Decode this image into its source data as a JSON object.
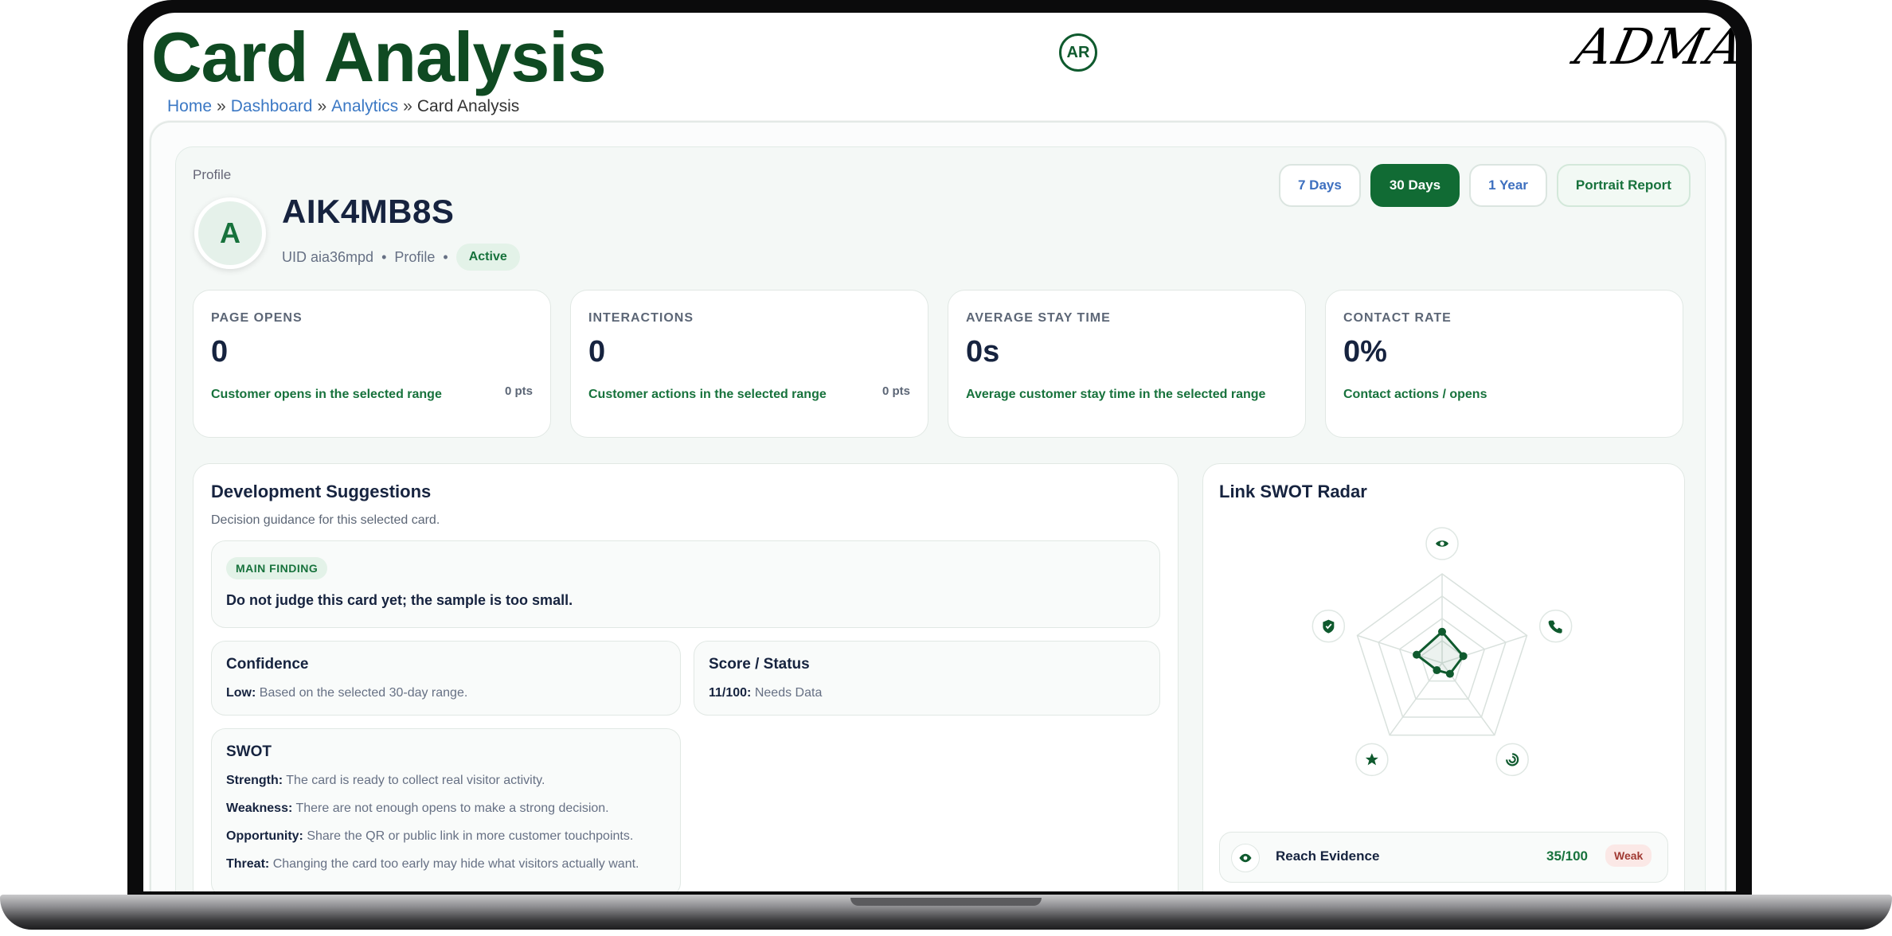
{
  "header": {
    "title": "Card Analysis",
    "user_initials": "AR",
    "brand": "ADMAL"
  },
  "breadcrumb": {
    "home": "Home",
    "dashboard": "Dashboard",
    "analytics": "Analytics",
    "current": "Card Analysis",
    "separator": "»"
  },
  "profile": {
    "section_label": "Profile",
    "avatar_letter": "A",
    "name": "AIK4MB8S",
    "uid": "UID aia36mpd",
    "type": "Profile",
    "bullet": "•",
    "status": "Active"
  },
  "range": {
    "options": [
      "7 Days",
      "30 Days",
      "1 Year"
    ],
    "selected": "30 Days",
    "report_label": "Portrait Report"
  },
  "kpis": [
    {
      "label": "PAGE OPENS",
      "value": "0",
      "desc": "Customer opens in the selected range",
      "pts": "0 pts"
    },
    {
      "label": "INTERACTIONS",
      "value": "0",
      "desc": "Customer actions in the selected range",
      "pts": "0 pts"
    },
    {
      "label": "AVERAGE STAY TIME",
      "value": "0s",
      "desc": "Average customer stay time in the selected range",
      "pts": ""
    },
    {
      "label": "CONTACT RATE",
      "value": "0%",
      "desc": "Contact actions / opens",
      "pts": ""
    }
  ],
  "development": {
    "title": "Development Suggestions",
    "subtitle": "Decision guidance for this selected card.",
    "finding_tag": "MAIN FINDING",
    "finding_text": "Do not judge this card yet; the sample is too small.",
    "confidence": {
      "title": "Confidence",
      "level": "Low:",
      "text": "Based on the selected 30-day range."
    },
    "score": {
      "title": "Score / Status",
      "value": "11/100:",
      "text": "Needs Data"
    },
    "swot": {
      "title": "SWOT",
      "items": [
        {
          "label": "Strength:",
          "text": "The card is ready to collect real visitor activity."
        },
        {
          "label": "Weakness:",
          "text": "There are not enough opens to make a strong decision."
        },
        {
          "label": "Opportunity:",
          "text": "Share the QR or public link in more customer touchpoints."
        },
        {
          "label": "Threat:",
          "text": "Changing the card too early may hide what visitors actually want."
        }
      ]
    }
  },
  "radar": {
    "title": "Link SWOT Radar",
    "axes_icons": [
      "eye-icon",
      "phone-icon",
      "swirl-icon",
      "star-icon",
      "shield-icon"
    ],
    "scores": [
      35,
      25,
      15,
      10,
      30
    ],
    "max": 100,
    "accent": "#0f5a2e",
    "evidence": {
      "label": "Reach Evidence",
      "score": "35/100",
      "badge": "Weak",
      "icon": "eye-icon"
    }
  },
  "colors": {
    "brand_green": "#0f4a22",
    "accent_green": "#17723c",
    "link_blue": "#3b78c4",
    "weak_badge": "#a13a33"
  }
}
